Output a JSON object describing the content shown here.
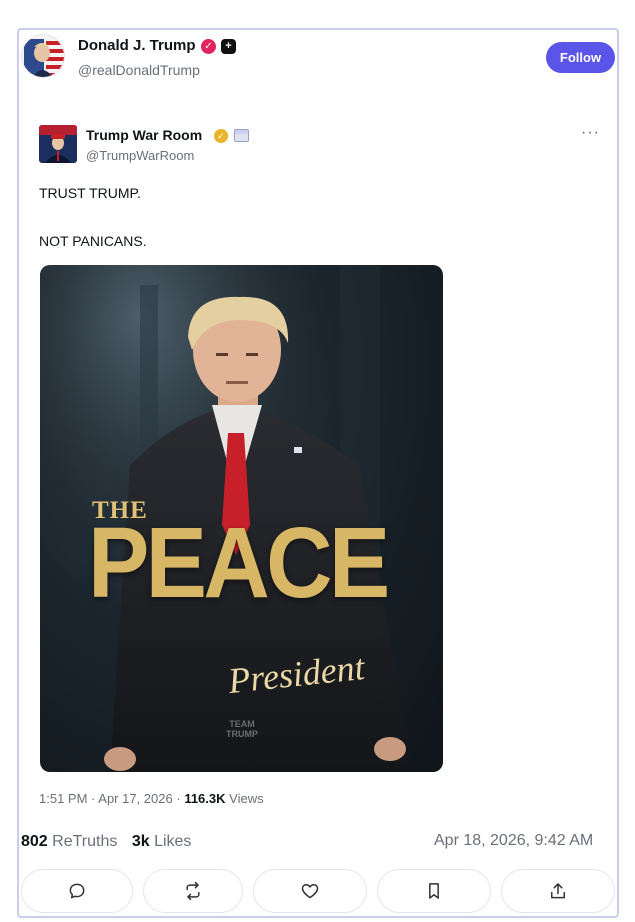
{
  "post": {
    "author_name": "Donald J. Trump",
    "author_handle": "@realDonaldTrump",
    "follow_label": "Follow"
  },
  "quoted": {
    "author_name": "Trump War Room",
    "author_handle": "@TrumpWarRoom",
    "more_label": "···",
    "text_line_1": "TRUST TRUMP.",
    "text_line_2": "NOT PANICANS.",
    "image": {
      "title_the": "THE",
      "title_main": "PEACE",
      "title_script": "President",
      "watermark_line_1": "TEAM",
      "watermark_line_2": "TRUMP"
    },
    "time": "1:51 PM",
    "date": "Apr 17, 2026",
    "views_count": "116.3K",
    "views_label": "Views"
  },
  "stats": {
    "retruths_count": "802",
    "retruths_label": "ReTruths",
    "likes_count": "3k",
    "likes_label": "Likes",
    "timestamp": "Apr 18, 2026, 9:42 AM"
  },
  "actions": [
    "reply-icon",
    "retruth-icon",
    "like-icon",
    "bookmark-icon",
    "share-icon"
  ],
  "colors": {
    "follow_button": "#5b54e8",
    "verified_red": "#e0245e",
    "verified_gold": "#e8b52b",
    "peace_gold": "#d7b766",
    "tie_red": "#c8202a"
  }
}
